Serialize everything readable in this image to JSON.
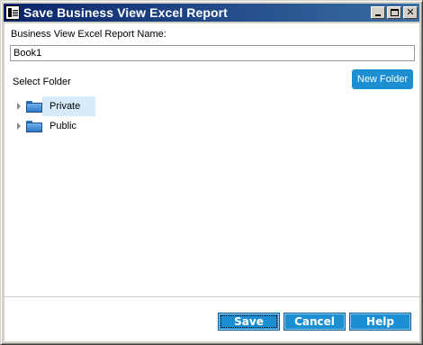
{
  "window": {
    "title": "Save Business View Excel Report",
    "minimize_glyph": "",
    "maximize_glyph": "",
    "close_glyph": "✕"
  },
  "form": {
    "name_label": "Business View Excel Report Name:",
    "name_value": "Book1",
    "folder_label": "Select Folder",
    "new_folder_label": "New Folder"
  },
  "tree": {
    "items": [
      {
        "label": "Private",
        "selected": true
      },
      {
        "label": "Public",
        "selected": false
      }
    ]
  },
  "footer": {
    "save_label": "Save",
    "cancel_label": "Cancel",
    "help_label": "Help"
  },
  "colors": {
    "accent": "#1b8fd2",
    "titlebar_start": "#0a246a",
    "titlebar_end": "#3a6ea5",
    "selection": "#d6ecfa"
  }
}
